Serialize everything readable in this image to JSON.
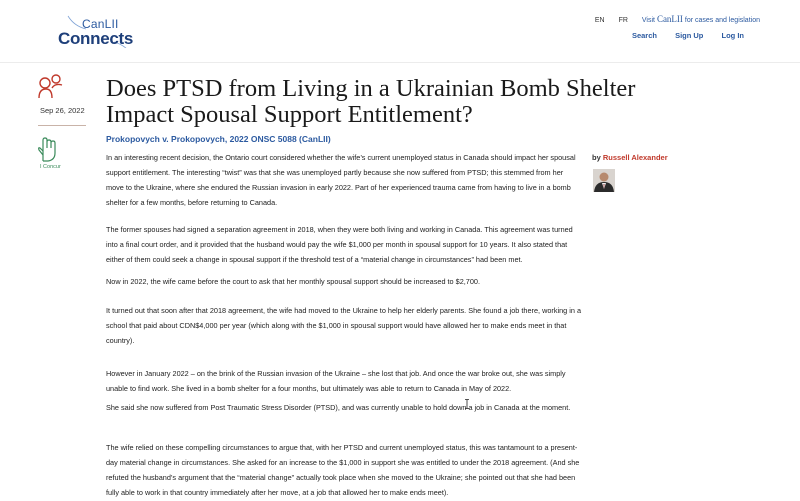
{
  "header": {
    "logo_canlii": "CanLII",
    "logo_connects": "Connects",
    "lang_en": "EN",
    "lang_fr": "FR",
    "visit_prefix": "Visit",
    "visit_brand": "CanLII",
    "visit_suffix": "for cases and legislation",
    "search_label": "Search",
    "signup_label": "Sign Up",
    "login_label": "Log In",
    "brand_color": "#2c5aa0"
  },
  "sidebar": {
    "date": "Sep 26, 2022",
    "concur_label": "I Concur"
  },
  "article": {
    "title": "Does PTSD from Living in a Ukrainian Bomb Shelter Impact Spousal Support Entitlement?",
    "case_link": "Prokopovych v. Prokopovych, 2022 ONSC 5088 (CanLII)",
    "by_prefix": "by",
    "author": "Russell Alexander",
    "paragraphs": [
      "In an interesting recent decision, the Ontario court considered whether the wife’s current unemployed status in Canada should impact her spousal support entitlement. The interesting “twist” was that she was unemployed partly because she now suffered from PTSD; this stemmed from her move to the Ukraine, where she endured the Russian invasion in early 2022. Part of her experienced trauma came from having to live in a bomb shelter for a few months, before returning to Canada.",
      "The former spouses had signed a separation agreement in 2018, when they were both living and working in Canada. This agreement was turned into a final court order, and it provided that the husband would pay the wife $1,000 per month in spousal support for 10 years. It also stated that either of them could seek a change in spousal support if the threshold test of a “material change in circumstances” had been met.",
      "Now in 2022, the wife came before the court to ask that her monthly spousal support should be increased to $2,700.",
      "It turned out that soon after that 2018 agreement, the wife had moved to the Ukraine to help her elderly parents. She found a job there, working in a school that paid about CDN$4,000 per year (which along with the $1,000 in spousal support would have allowed her to make ends meet in that country).",
      "However in January 2022 – on the brink of the Russian invasion of the Ukraine – she lost that job. And once the war broke out, she was simply unable to find work. She lived in a bomb shelter for a four months, but ultimately was able to return to Canada in May of 2022.",
      "She said she now suffered from Post Traumatic Stress Disorder (PTSD), and was currently unable to hold down a job in Canada at the moment.",
      "The wife relied on these compelling circumstances to argue that, with her PTSD and current unemployed status, this was tantamount to a present-day material change in circumstances.  She asked for an increase to the $1,000 in support she was entitled to under the 2018 agreement. (And she refuted the husband’s argument that the “material change” actually took place when she moved to the Ukraine; she pointed out that she had been fully able to work in that country immediately after her move, at a job that allowed her to make ends meet)."
    ]
  }
}
